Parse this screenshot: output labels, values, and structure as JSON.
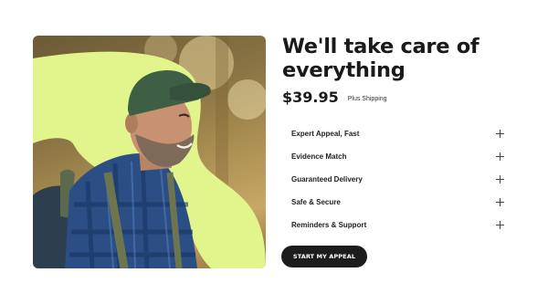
{
  "hero": {
    "alt": "Smiling man with a backpack in a forest",
    "accent_color": "#e2f58c"
  },
  "title": "We'll take care of everything",
  "price": "$39.95",
  "shipping_note": "Plus Shipping",
  "features": [
    {
      "label": "Expert Appeal, Fast",
      "icon": "plus-icon"
    },
    {
      "label": "Evidence Match",
      "icon": "plus-icon"
    },
    {
      "label": "Guaranteed Delivery",
      "icon": "plus-icon"
    },
    {
      "label": "Safe & Secure",
      "icon": "plus-icon"
    },
    {
      "label": "Reminders & Support",
      "icon": "plus-icon"
    }
  ],
  "cta_label": "START MY APPEAL",
  "colors": {
    "accent": "#e2f58c",
    "button": "#1c1c1c"
  }
}
